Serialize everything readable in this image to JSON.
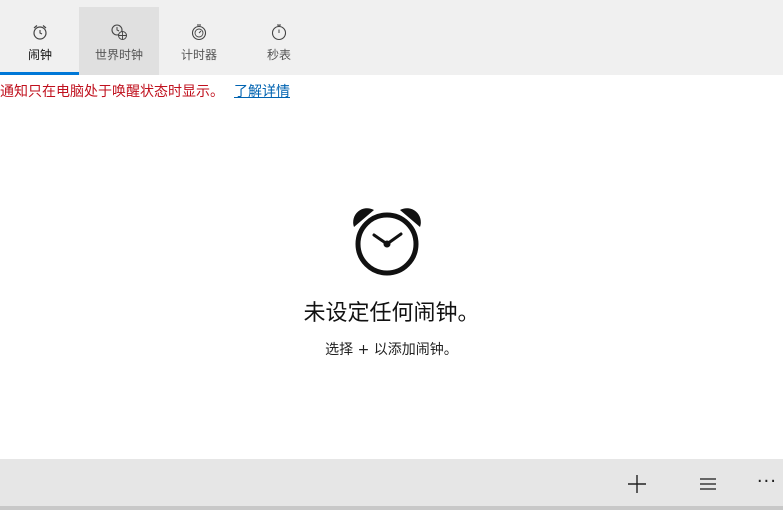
{
  "tabs": [
    {
      "label": "闹钟",
      "icon": "alarm-clock-icon"
    },
    {
      "label": "世界时钟",
      "icon": "world-clock-icon"
    },
    {
      "label": "计时器",
      "icon": "timer-icon"
    },
    {
      "label": "秒表",
      "icon": "stopwatch-icon"
    }
  ],
  "notice": {
    "text": "通知只在电脑处于唤醒状态时显示。",
    "link": "了解详情"
  },
  "empty": {
    "title": "未设定任何闹钟。",
    "subtitle": "选择 + 以添加闹钟。"
  },
  "commands": {
    "add": "add-icon",
    "select": "select-list-icon",
    "more": "···"
  },
  "colors": {
    "accent": "#0078d7",
    "notice": "#c0111e",
    "link": "#0063b1"
  }
}
